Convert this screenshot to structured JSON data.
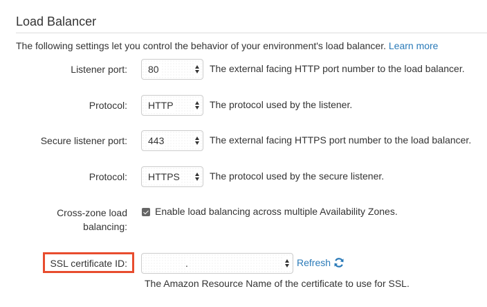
{
  "section": {
    "title": "Load Balancer",
    "intro": "The following settings let you control the behavior of your environment's load balancer.",
    "learn_more": "Learn more"
  },
  "fields": {
    "listener_port": {
      "label": "Listener port:",
      "value": "80",
      "desc": "The external facing HTTP port number to the load balancer."
    },
    "protocol": {
      "label": "Protocol:",
      "value": "HTTP",
      "desc": "The protocol used by the listener."
    },
    "secure_listener_port": {
      "label": "Secure listener port:",
      "value": "443",
      "desc": "The external facing HTTPS port number to the load balancer."
    },
    "secure_protocol": {
      "label": "Protocol:",
      "value": "HTTPS",
      "desc": "The protocol used by the secure listener."
    },
    "cross_zone": {
      "label": "Cross-zone load balancing:",
      "checked": true,
      "desc": "Enable load balancing across multiple Availability Zones."
    },
    "ssl_certificate": {
      "label": "SSL certificate ID:",
      "value": ".",
      "refresh": "Refresh",
      "desc": "The Amazon Resource Name of the certificate to use for SSL."
    }
  },
  "icons": {
    "select_arrows": "up-down-chevron-icon",
    "refresh": "refresh-icon",
    "checkbox": "checkmark-icon"
  },
  "colors": {
    "link": "#2a7ab8",
    "highlight": "#e84c2e",
    "text": "#333333",
    "border": "#cccccc"
  }
}
